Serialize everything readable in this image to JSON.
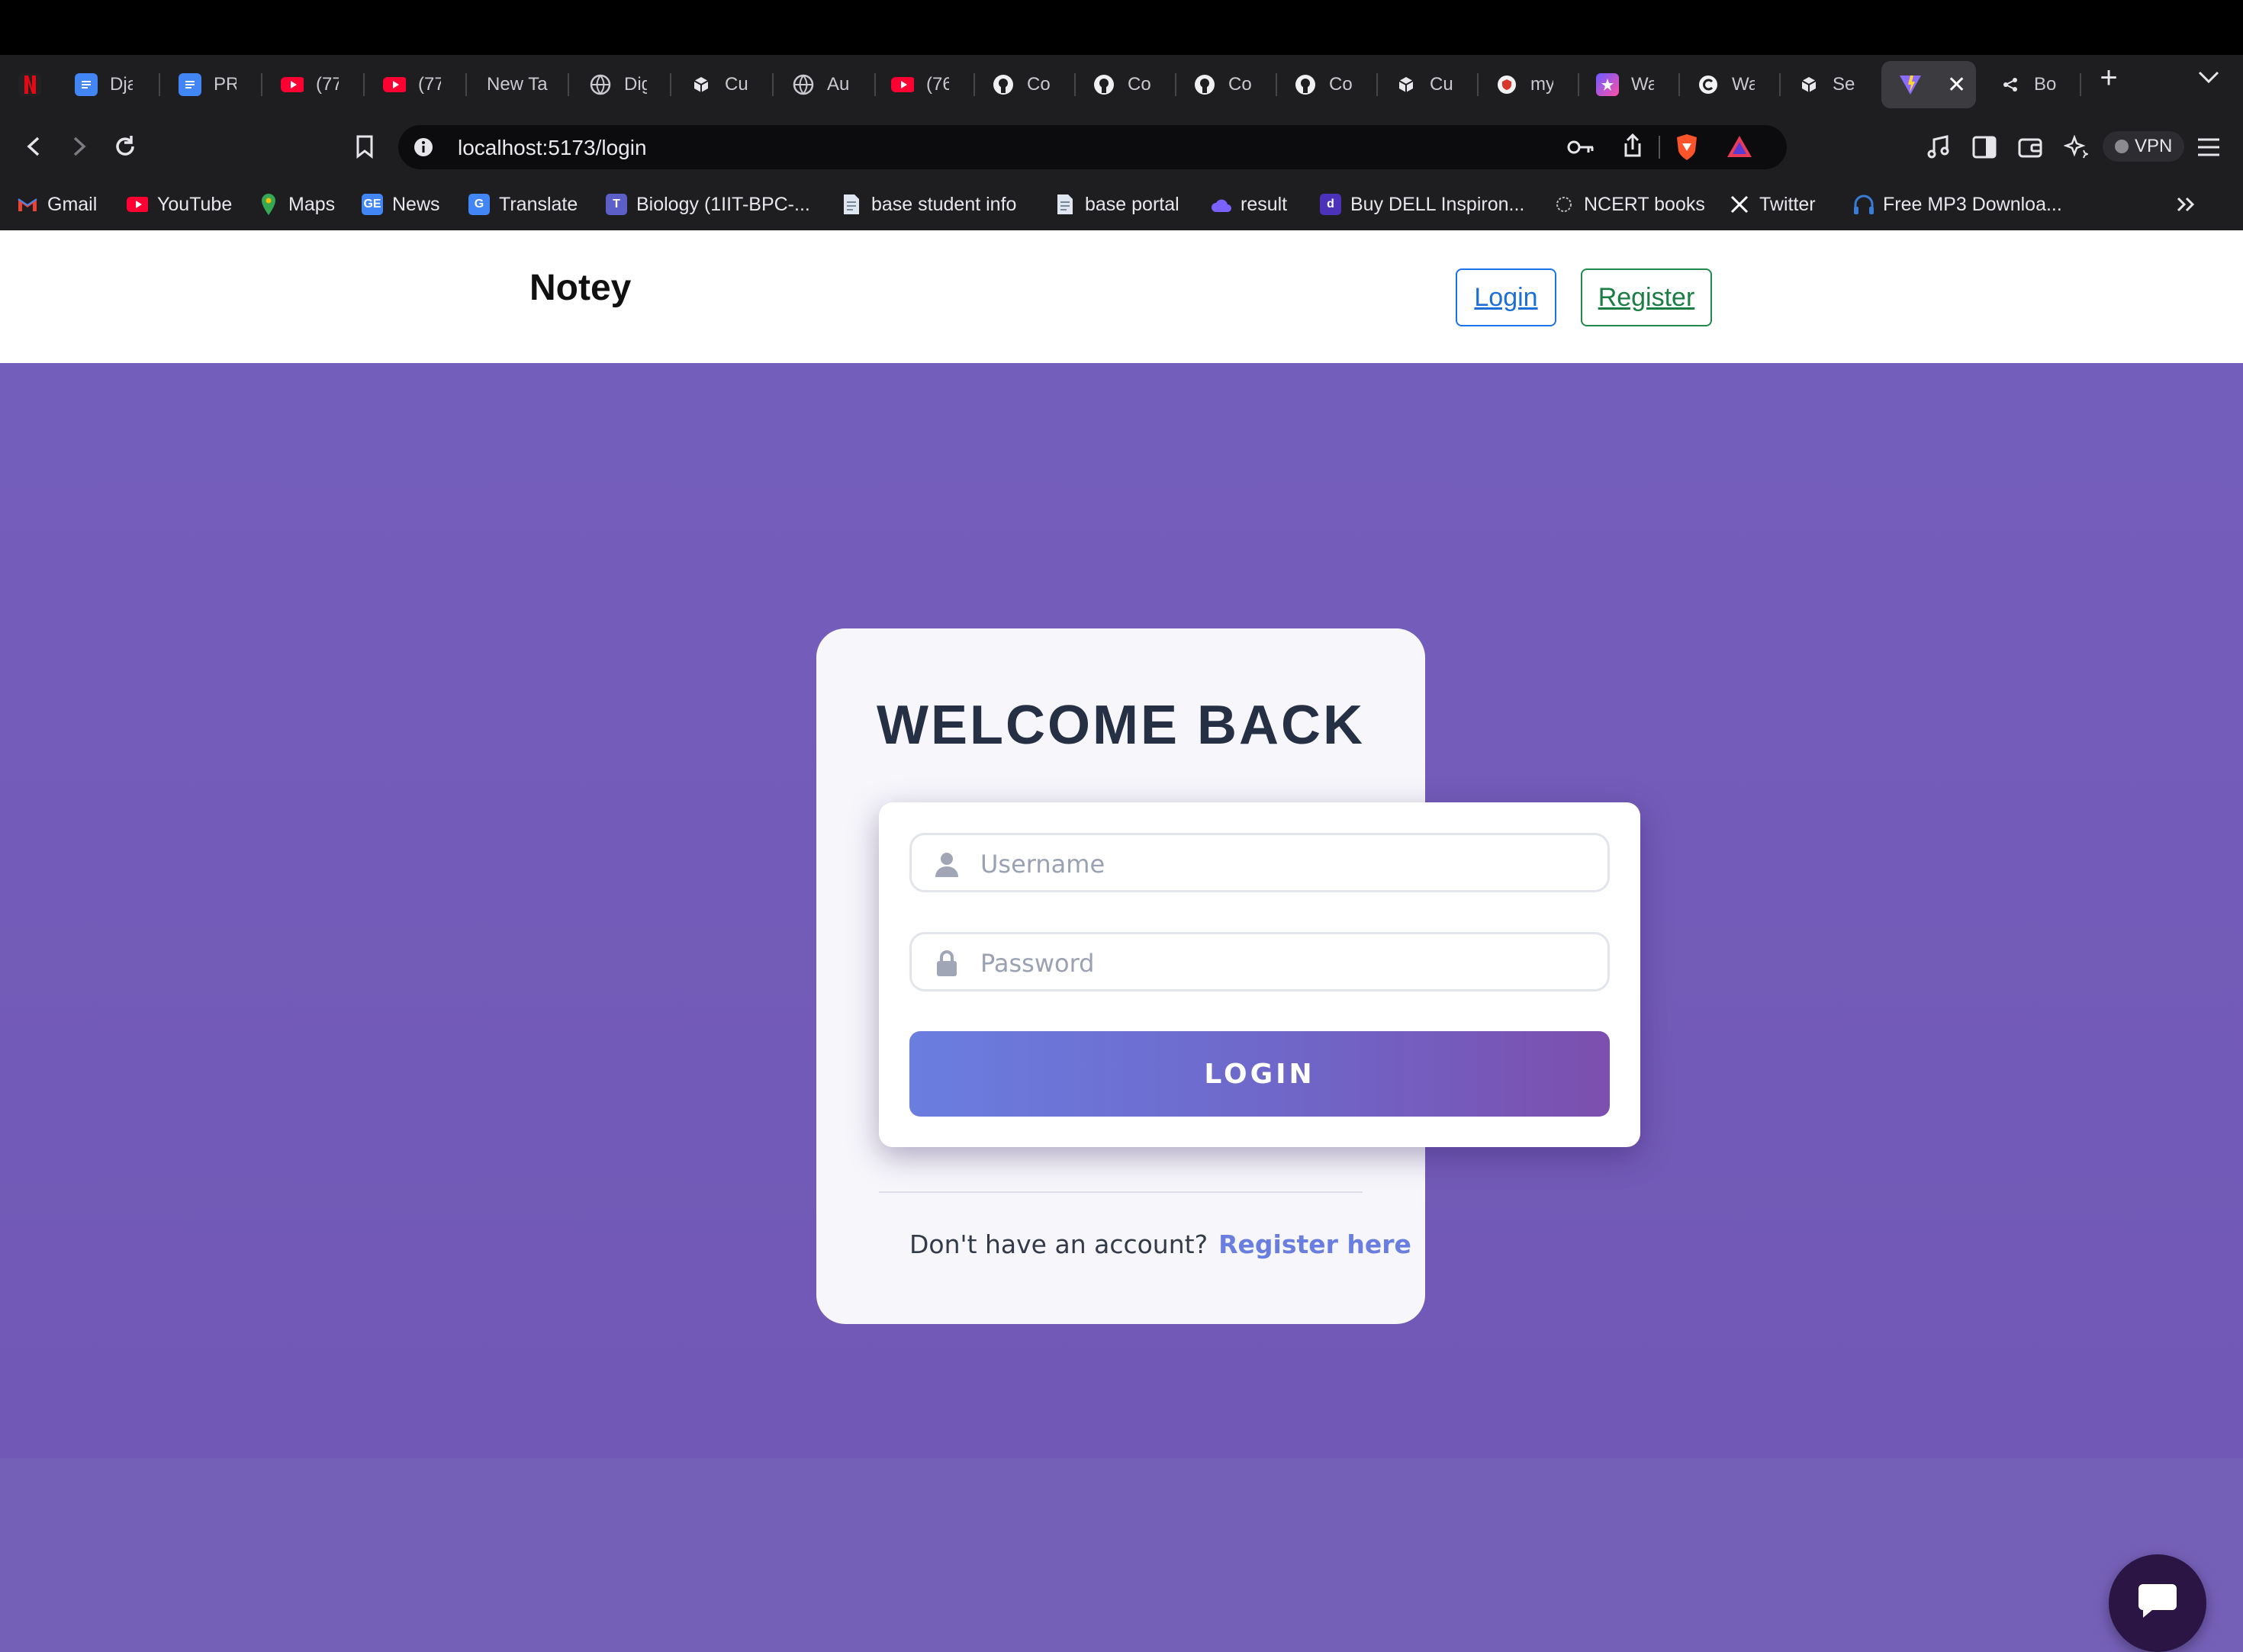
{
  "browser": {
    "tabs": [
      {
        "title": "",
        "icon": "netflix-icon"
      },
      {
        "title": "Dja",
        "icon": "docs-icon"
      },
      {
        "title": "PR(",
        "icon": "docs-icon"
      },
      {
        "title": "(77",
        "icon": "youtube-icon"
      },
      {
        "title": "(77",
        "icon": "youtube-icon"
      },
      {
        "title": "New Ta",
        "icon": ""
      },
      {
        "title": "Dig",
        "icon": "globe-icon"
      },
      {
        "title": "Cu",
        "icon": "cube-icon"
      },
      {
        "title": "Au",
        "icon": "globe-icon"
      },
      {
        "title": "(76",
        "icon": "youtube-icon"
      },
      {
        "title": "Co",
        "icon": "github-icon"
      },
      {
        "title": "Co",
        "icon": "github-icon"
      },
      {
        "title": "Co",
        "icon": "github-icon"
      },
      {
        "title": "Co",
        "icon": "github-icon"
      },
      {
        "title": "Cu",
        "icon": "cube-icon"
      },
      {
        "title": "my",
        "icon": "shield-icon"
      },
      {
        "title": "Wa",
        "icon": "star-icon"
      },
      {
        "title": "Wa",
        "icon": "c-icon"
      },
      {
        "title": "Se",
        "icon": "cube-icon"
      },
      {
        "title": "",
        "icon": "vite-icon",
        "active": true
      },
      {
        "title": "Bo",
        "icon": "share-icon"
      }
    ],
    "url": "localhost:5173/login",
    "vpn_label": "VPN",
    "bookmarks": [
      {
        "label": "Gmail",
        "icon": "gmail-icon",
        "color": "#ea4335"
      },
      {
        "label": "YouTube",
        "icon": "youtube-icon",
        "color": "#ff0000"
      },
      {
        "label": "Maps",
        "icon": "maps-icon",
        "color": "#34a853"
      },
      {
        "label": "News",
        "icon": "news-icon",
        "color": "#4285f4"
      },
      {
        "label": "Translate",
        "icon": "translate-icon",
        "color": "#4285f4"
      },
      {
        "label": "Biology (1IIT-BPC-...",
        "icon": "teams-icon",
        "color": "#5b5fc7"
      },
      {
        "label": "base student info",
        "icon": "doc-icon",
        "color": "#cfd8e3"
      },
      {
        "label": "base portal",
        "icon": "doc-icon",
        "color": "#cfd8e3"
      },
      {
        "label": "result",
        "icon": "cloud-icon",
        "color": "#7b61ff"
      },
      {
        "label": "Buy DELL Inspiron...",
        "icon": "dell-icon",
        "color": "#5b3fd0"
      },
      {
        "label": "NCERT books",
        "icon": "ncert-icon",
        "color": "#999999"
      },
      {
        "label": "Twitter",
        "icon": "x-icon",
        "color": "#000000"
      },
      {
        "label": "Free MP3 Downloa...",
        "icon": "headphones-icon",
        "color": "#3a7bd5"
      }
    ]
  },
  "app": {
    "brand": "Notey",
    "nav": {
      "login": "Login",
      "register": "Register"
    },
    "card": {
      "title": "WELCOME BACK",
      "username_placeholder": "Username",
      "password_placeholder": "Password",
      "login_button": "LOGIN",
      "signup_prompt": "Don't have an account?",
      "signup_link": "Register here"
    },
    "colors": {
      "accent": "#6a7ee0",
      "background": "#745fbc",
      "chat_button": "#2a1545"
    }
  }
}
